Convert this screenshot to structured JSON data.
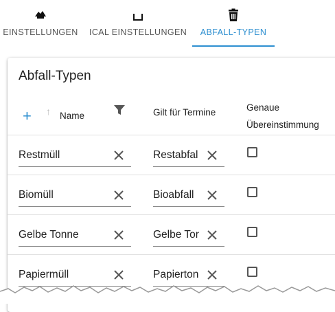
{
  "tabs": [
    {
      "label": "EINSTELLUNGEN",
      "icon": "settings-icon",
      "active": false
    },
    {
      "label": "ICAL EINSTELLUNGEN",
      "icon": "calendar-icon",
      "active": false
    },
    {
      "label": "ABFALL-TYPEN",
      "icon": "trash-icon",
      "active": true
    }
  ],
  "card": {
    "title": "Abfall-Typen",
    "headers": {
      "name": "Name",
      "gilt": "Gilt für Termine",
      "genaue_line1": "Genaue",
      "genaue_line2": "Übereinstimmung"
    },
    "rows": [
      {
        "name": "Restmüll",
        "gilt": "Restabfal",
        "exact": false
      },
      {
        "name": "Biomüll",
        "gilt": "Bioabfall",
        "exact": false
      },
      {
        "name": "Gelbe Tonne",
        "gilt": "Gelbe Tor",
        "exact": false
      },
      {
        "name": "Papiermüll",
        "gilt": "Papierton",
        "exact": false
      }
    ]
  },
  "colors": {
    "accent": "#2d8fd0",
    "text": "#212121",
    "divider": "#e0e0e0"
  }
}
